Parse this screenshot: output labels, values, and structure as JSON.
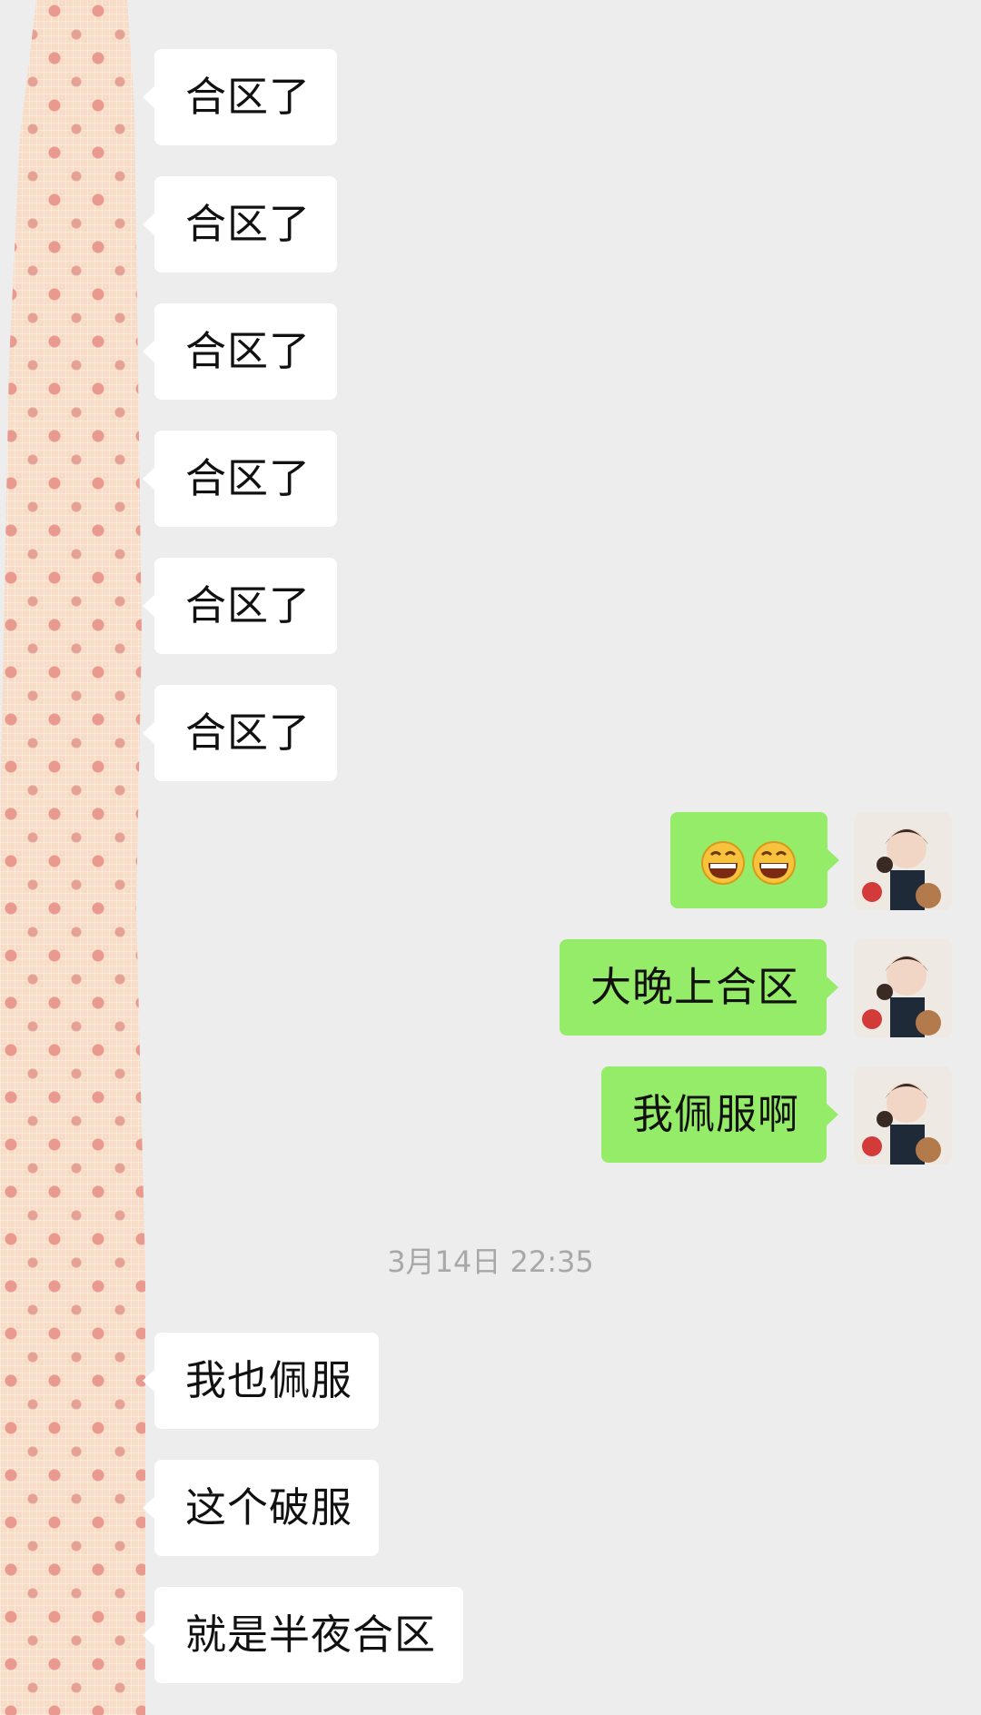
{
  "messages_before": [
    {
      "text": "合区了"
    },
    {
      "text": "合区了"
    },
    {
      "text": "合区了"
    },
    {
      "text": "合区了"
    },
    {
      "text": "合区了"
    },
    {
      "text": "合区了"
    }
  ],
  "my_messages": [
    {
      "emoji": [
        "grinning-face-emoji",
        "grinning-face-emoji"
      ]
    },
    {
      "text": "大晚上合区"
    },
    {
      "text": "我佩服啊"
    }
  ],
  "timestamp": "3月14日 22:35",
  "messages_after": [
    {
      "text": "我也佩服"
    },
    {
      "text": "这个破服"
    },
    {
      "text": "就是半夜合区"
    }
  ],
  "colors": {
    "background": "#ededed",
    "incoming_bubble": "#ffffff",
    "outgoing_bubble": "#95ec69",
    "timestamp": "#a8a8a8"
  }
}
